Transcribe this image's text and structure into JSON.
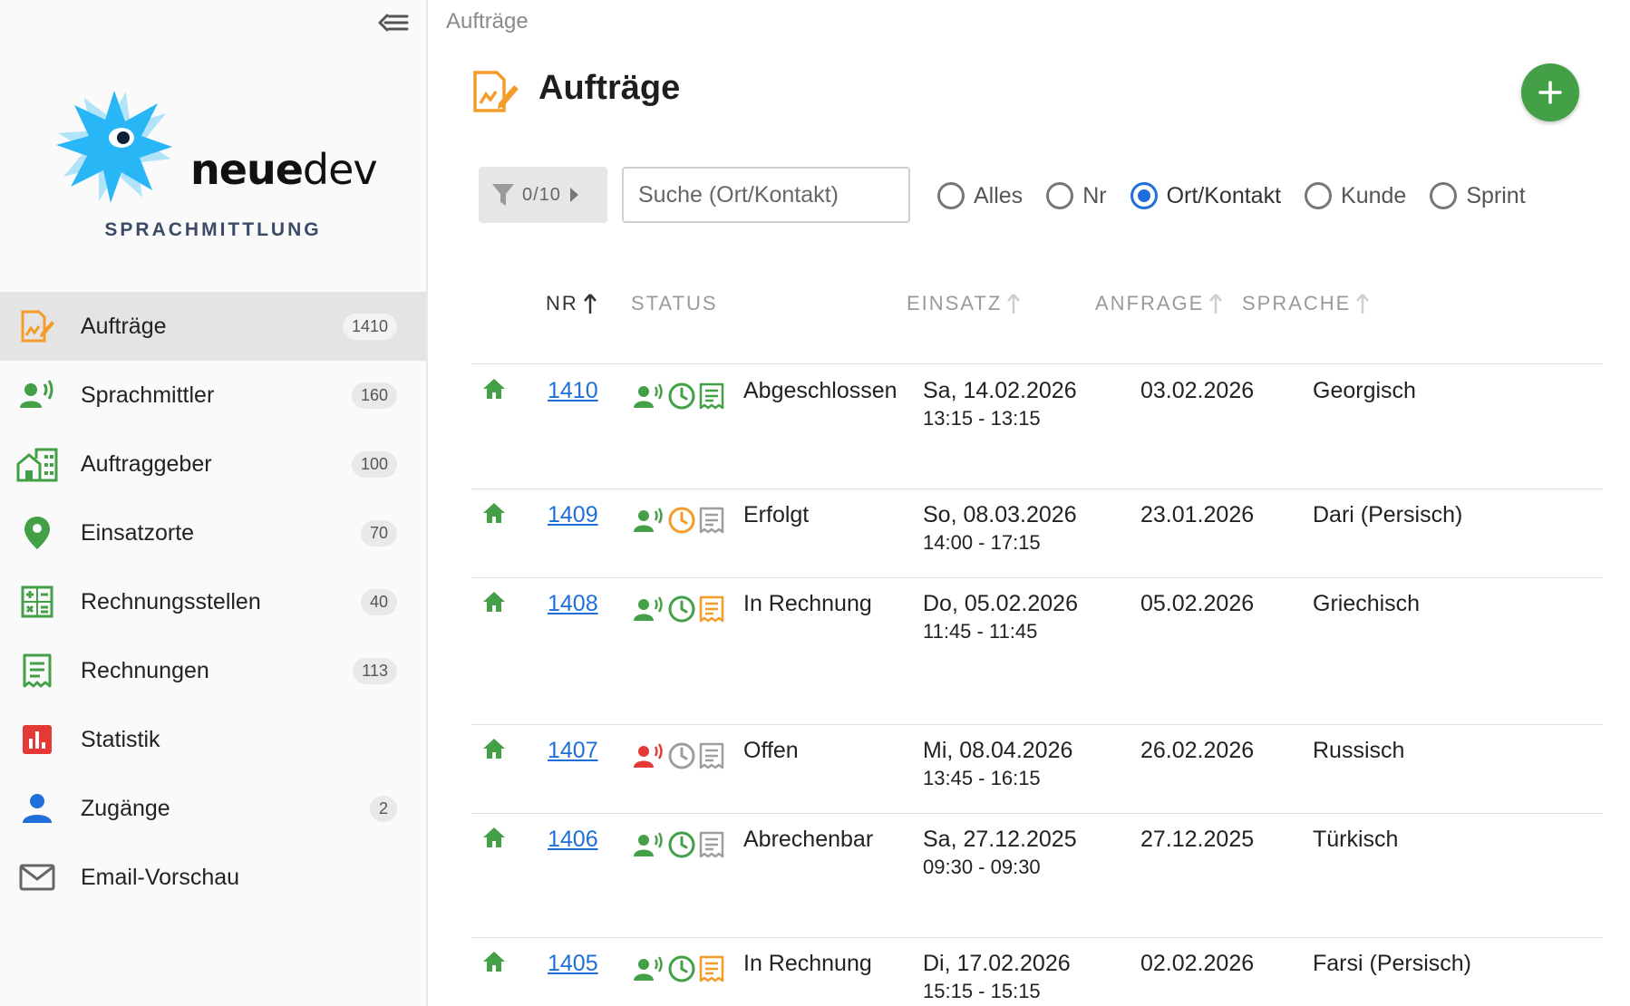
{
  "colors": {
    "accent_blue": "#1e6fd9",
    "green": "#43a047",
    "orange": "#f39c27",
    "red": "#e53935",
    "gray": "#9e9e9e",
    "logo_blue": "#29b6f6"
  },
  "sidebar": {
    "brand_prefix": "neue",
    "brand_suffix": "dev",
    "brand_subtitle": "SPRACHMITTLUNG",
    "items": [
      {
        "label": "Aufträge",
        "count": "1410",
        "icon": "orders-icon",
        "active": true
      },
      {
        "label": "Sprachmittler",
        "count": "160",
        "icon": "interpreter-icon"
      },
      {
        "label": "Auftraggeber",
        "count": "100",
        "icon": "client-building-icon"
      },
      {
        "label": "Einsatzorte",
        "count": "70",
        "icon": "location-pin-icon"
      },
      {
        "label": "Rechnungsstellen",
        "count": "40",
        "icon": "calculator-icon"
      },
      {
        "label": "Rechnungen",
        "count": "113",
        "icon": "receipt-icon"
      },
      {
        "label": "Statistik",
        "count": "",
        "icon": "chart-icon"
      },
      {
        "label": "Zugänge",
        "count": "2",
        "icon": "person-icon"
      },
      {
        "label": "Email-Vorschau",
        "count": "",
        "icon": "mail-icon"
      }
    ]
  },
  "breadcrumb": "Aufträge",
  "page_title": "Aufträge",
  "filter": {
    "label": "0/10"
  },
  "search": {
    "placeholder": "Suche (Ort/Kontakt)"
  },
  "radio_options": [
    {
      "label": "Alles",
      "checked": false
    },
    {
      "label": "Nr",
      "checked": false
    },
    {
      "label": "Ort/Kontakt",
      "checked": true
    },
    {
      "label": "Kunde",
      "checked": false
    },
    {
      "label": "Sprint",
      "checked": false
    }
  ],
  "table": {
    "headers": {
      "nr": "NR",
      "status": "STATUS",
      "einsatz": "EINSATZ",
      "anfrage": "ANFRAGE",
      "sprache": "SPRACHE"
    },
    "rows": [
      {
        "nr": "1410",
        "status": "Abgeschlossen",
        "einsatz_date": "Sa, 14.02.2026",
        "einsatz_time": "13:15 - 13:15",
        "anfrage": "03.02.2026",
        "sprache": "Georgisch",
        "person_color": "green",
        "clock_color": "green",
        "receipt_color": "green"
      },
      {
        "nr": "1409",
        "status": "Erfolgt",
        "einsatz_date": "So, 08.03.2026",
        "einsatz_time": "14:00 - 17:15",
        "anfrage": "23.01.2026",
        "sprache": "Dari (Persisch)",
        "person_color": "green",
        "clock_color": "orange",
        "receipt_color": "gray"
      },
      {
        "nr": "1408",
        "status": "In Rechnung",
        "einsatz_date": "Do, 05.02.2026",
        "einsatz_time": "11:45 - 11:45",
        "anfrage": "05.02.2026",
        "sprache": "Griechisch",
        "person_color": "green",
        "clock_color": "green",
        "receipt_color": "orange"
      },
      {
        "nr": "1407",
        "status": "Offen",
        "einsatz_date": "Mi, 08.04.2026",
        "einsatz_time": "13:45 - 16:15",
        "anfrage": "26.02.2026",
        "sprache": "Russisch",
        "person_color": "red",
        "clock_color": "gray",
        "receipt_color": "gray"
      },
      {
        "nr": "1406",
        "status": "Abrechenbar",
        "einsatz_date": "Sa, 27.12.2025",
        "einsatz_time": "09:30 - 09:30",
        "anfrage": "27.12.2025",
        "sprache": "Türkisch",
        "person_color": "green",
        "clock_color": "green",
        "receipt_color": "gray"
      },
      {
        "nr": "1405",
        "status": "In Rechnung",
        "einsatz_date": "Di, 17.02.2026",
        "einsatz_time": "15:15 - 15:15",
        "anfrage": "02.02.2026",
        "sprache": "Farsi (Persisch)",
        "person_color": "green",
        "clock_color": "green",
        "receipt_color": "orange"
      }
    ]
  }
}
